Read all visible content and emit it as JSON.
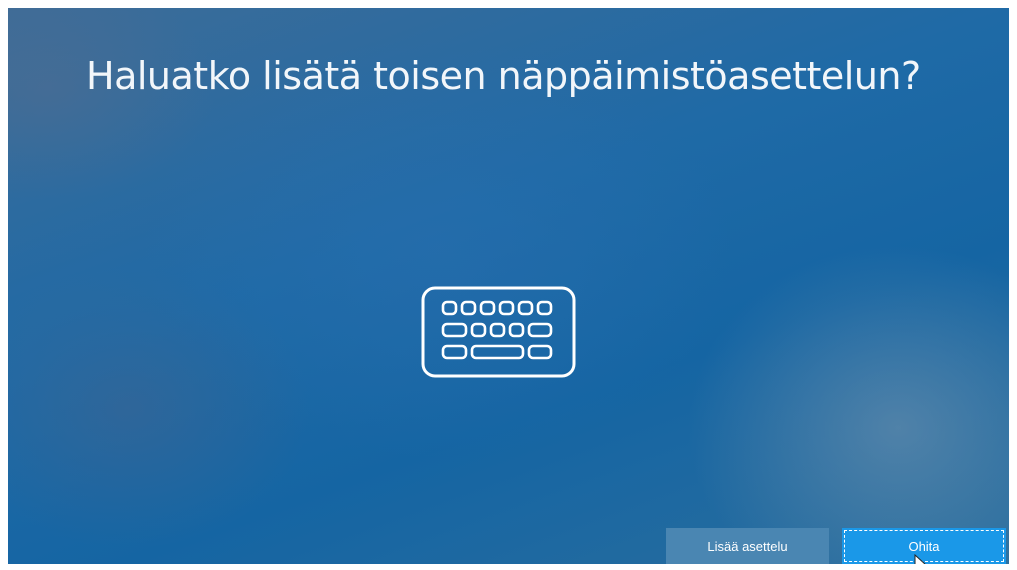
{
  "heading": "Haluatko lisätä toisen näppäimistöasettelun?",
  "icon": "keyboard-icon",
  "buttons": {
    "add_layout": "Lisää asettelu",
    "skip": "Ohita"
  },
  "colors": {
    "background": "#1f6aa6",
    "primary_button": "#1a98e8",
    "secondary_button": "#4a86b2",
    "text": "#ffffff"
  }
}
